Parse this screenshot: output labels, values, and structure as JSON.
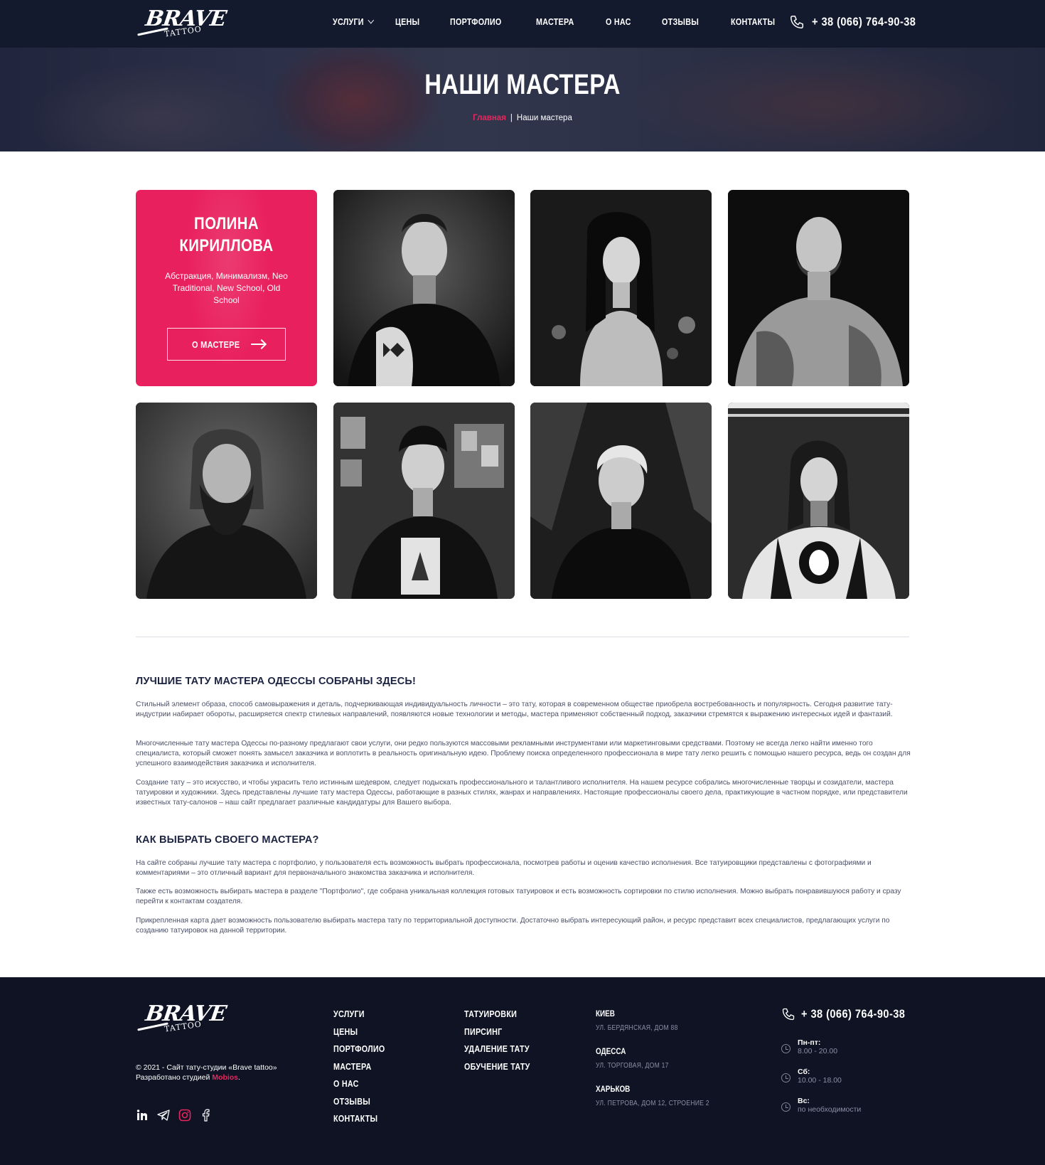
{
  "header": {
    "logo": {
      "word1": "BRAVE",
      "word2": "TATTOO"
    },
    "nav": [
      "УСЛУГИ",
      "ЦЕНЫ",
      "ПОРТФОЛИО",
      "МАСТЕРА",
      "О НАС",
      "ОТЗЫВЫ",
      "КОНТАКТЫ"
    ],
    "phone": "+ 38 (066) 764-90-38"
  },
  "hero": {
    "title": "НАШИ МАСТЕРА",
    "breadcrumb_home": "Главная",
    "breadcrumb_sep": "|",
    "breadcrumb_current": "Наши мастера"
  },
  "featured": {
    "name_line1": "ПОЛИНА",
    "name_line2": "КИРИЛЛОВА",
    "styles": "Абстракция, Минимализм, Neo Traditional, New School, Old School",
    "button": "О МАСТЕРЕ"
  },
  "section1": {
    "title": "ЛУЧШИЕ ТАТУ МАСТЕРА ОДЕССЫ СОБРАНЫ ЗДЕСЬ!",
    "p1": "Стильный элемент образа, способ самовыражения и деталь, подчеркивающая индивидуальность личности – это тату, которая в современном обществе приобрела востребованность и популярность. Сегодня развитие тату-индустрии набирает обороты, расширяется спектр стилевых направлений, появляются новые технологии и методы, мастера применяют собственный подход, заказчики стремятся к выражению интересных идей и фантазий.",
    "p2": "Многочисленные тату мастера Одессы по-разному предлагают свои услуги, они редко пользуются массовыми рекламными инструментами или маркетинговыми средствами. Поэтому не всегда легко найти именно того специалиста, который сможет понять замысел заказчика и воплотить в реальность оригинальную идею. Проблему поиска определенного профессионала в мире тату легко решить с помощью нашего ресурса, ведь он создан для успешного взаимодействия заказчика и исполнителя.",
    "p3": "Создание тату – это искусство, и чтобы украсить тело истинным шедевром, следует подыскать профессионального и талантливого исполнителя. На нашем ресурсе собрались многочисленные творцы и созидатели, мастера татуировки и художники. Здесь представлены лучшие тату мастера Одессы, работающие в разных стилях, жанрах и направлениях. Настоящие профессионалы своего дела, практикующие в частном порядке, или представители известных тату-салонов – наш сайт предлагает различные кандидатуры для Вашего выбора."
  },
  "section2": {
    "title": "КАК ВЫБРАТЬ СВОЕГО МАСТЕРА?",
    "p1": "На сайте собраны лучшие тату мастера с портфолио, у пользователя есть возможность выбрать профессионала, посмотрев работы и оценив качество исполнения. Все татуировщики представлены с фотографиями и комментариями – это отличный вариант для первоначального знакомства заказчика и исполнителя.",
    "p2": "Также есть возможность выбирать мастера в разделе \"Портфолио\", где собрана уникальная коллекция готовых татуировок и есть возможность сортировки по стилю исполнения. Можно выбрать понравившуюся работу и сразу перейти к контактам создателя.",
    "p3": "Прикрепленная карта дает возможность пользователю выбирать мастера тату по территориальной доступности. Достаточно выбрать интересующий район, и ресурс представит всех специалистов, предлагающих услуги по созданию татуировок на данной территории."
  },
  "footer": {
    "copyright": "© 2021 - Сайт тату-студии «Brave tattoo»",
    "developed": "Разработано студией ",
    "studio": "Mobios",
    "studio_end": ".",
    "col1": [
      "УСЛУГИ",
      "ЦЕНЫ",
      "ПОРТФОЛИО",
      "МАСТЕРА",
      "О НАС",
      "ОТЗЫВЫ",
      "КОНТАКТЫ"
    ],
    "col2": [
      "ТАТУИРОВКИ",
      "ПИРСИНГ",
      "УДАЛЕНИЕ ТАТУ",
      "ОБУЧЕНИЕ ТАТУ"
    ],
    "cities": [
      {
        "city": "КИЕВ",
        "address": "УЛ. БЕРДЯНСКАЯ, ДОМ 88"
      },
      {
        "city": "ОДЕССА",
        "address": "УЛ. ТОРГОВАЯ, ДОМ 17"
      },
      {
        "city": "ХАРЬКОВ",
        "address": "УЛ. ПЕТРОВА, ДОМ 12, СТРОЕНИЕ 2"
      }
    ],
    "phone": "+ 38 (066) 764-90-38",
    "hours": [
      {
        "days": "Пн-пт:",
        "time": "8.00 - 20.00"
      },
      {
        "days": "Сб:",
        "time": "10.00 - 18.00"
      },
      {
        "days": "Вс:",
        "time": "по необходимости"
      }
    ],
    "social_icons": [
      "linkedin-icon",
      "telegram-icon",
      "instagram-icon",
      "facebook-icon"
    ]
  },
  "colors": {
    "accent": "#e9205e",
    "header": "#131a2e",
    "footer": "#0f1323",
    "text": "#4b5068"
  }
}
